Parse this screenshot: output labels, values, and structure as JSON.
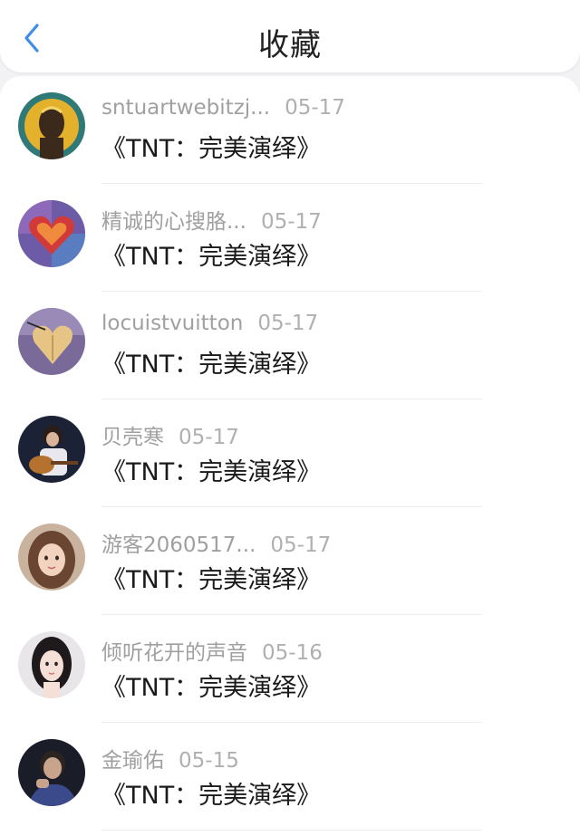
{
  "header": {
    "title": "收藏",
    "back_icon": "chevron-left-icon",
    "accent": "#3d8ee8"
  },
  "items": [
    {
      "name": "sntuartwebitzj...",
      "date": "05-17",
      "title": "《TNT：完美演绎》",
      "avatar_icon": "avatar-portrait-yellow"
    },
    {
      "name": "精诚的心搜胳...",
      "date": "05-17",
      "title": "《TNT：完美演绎》",
      "avatar_icon": "avatar-heart-mosaic"
    },
    {
      "name": "locuistvuitton",
      "date": "05-17",
      "title": "《TNT：完美演绎》",
      "avatar_icon": "avatar-heart-leaf"
    },
    {
      "name": "贝壳寒",
      "date": "05-17",
      "title": "《TNT：完美演绎》",
      "avatar_icon": "avatar-guitar-player"
    },
    {
      "name": "游客2060517...",
      "date": "05-17",
      "title": "《TNT：完美演绎》",
      "avatar_icon": "avatar-girl-portrait"
    },
    {
      "name": "倾听花开的声音",
      "date": "05-16",
      "title": "《TNT：完美演绎》",
      "avatar_icon": "avatar-woman-portrait"
    },
    {
      "name": "金瑜佑",
      "date": "05-15",
      "title": "《TNT：完美演绎》",
      "avatar_icon": "avatar-man-portrait"
    }
  ]
}
